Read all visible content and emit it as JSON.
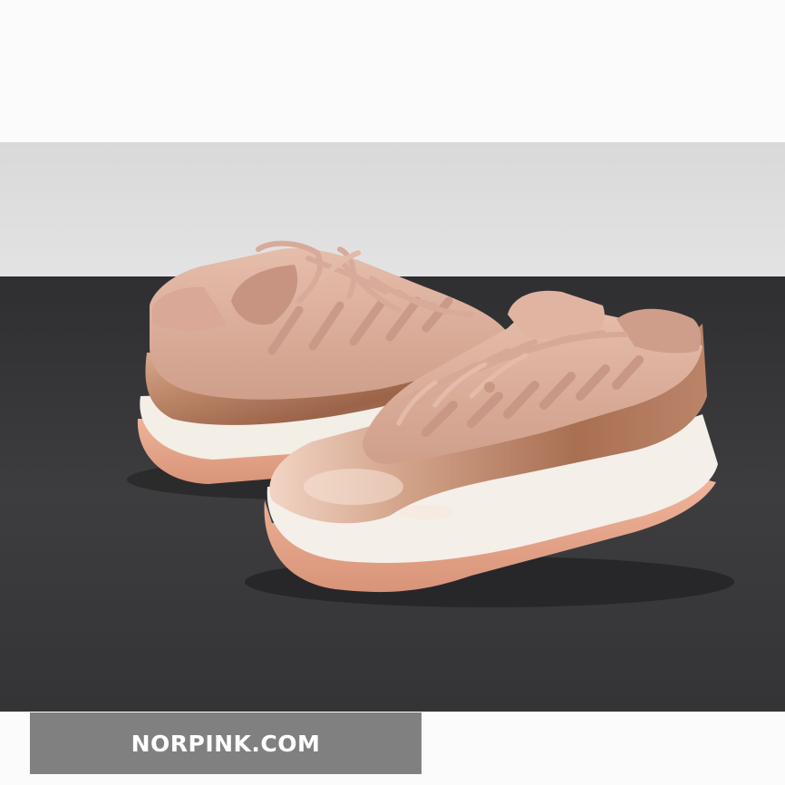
{
  "photo": {
    "subject_icon": "sneaker-pair-icon",
    "colors": {
      "backdrop": "#dadada",
      "table": "#3a3a3c",
      "upper": "#d7aa98",
      "metallic": "#b07a5e",
      "midsole": "#f3efe8",
      "outsole": "#e7ab8f"
    }
  },
  "watermark": {
    "label": "NORPINK.COM",
    "background": "#808080"
  }
}
